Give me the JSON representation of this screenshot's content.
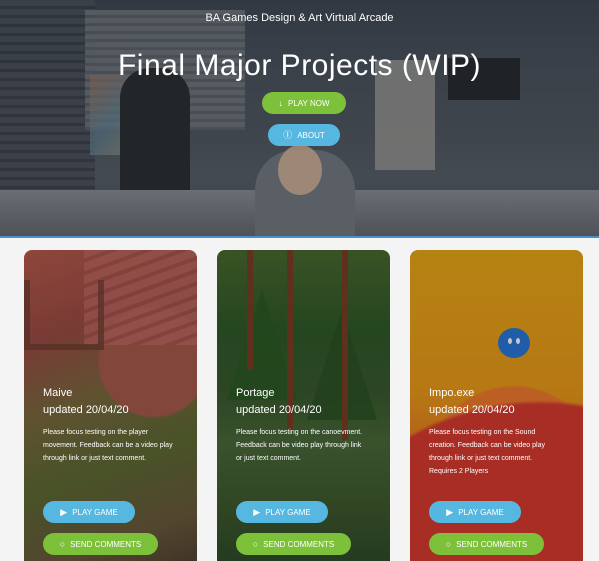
{
  "hero": {
    "subtitle": "BA Games Design & Art Virtual Arcade",
    "title": "Final Major Projects (WIP)",
    "play_now_label": "PLAY NOW",
    "about_label": "ABOUT"
  },
  "colors": {
    "green": "#7dc13a",
    "blue": "#56b8e0",
    "hero_accent": "#4a90c8"
  },
  "icons": {
    "play_now": "download-arrow-icon",
    "about": "question-circle-icon",
    "play_game": "play-circle-icon",
    "send_comments": "comment-icon"
  },
  "cards": [
    {
      "title": "Maive",
      "updated": "updated 20/04/20",
      "description": "Please focus testing on the player movement. Feedback can be a video play through link or just text comment.",
      "play_label": "PLAY GAME",
      "send_label": "SEND COMMENTS"
    },
    {
      "title": "Portage",
      "updated": "updated 20/04/20",
      "description": "Please focus testing on the canoevment. Feedback can be video play through link or just text comment.",
      "play_label": "PLAY GAME",
      "send_label": "SEND COMMENTS"
    },
    {
      "title": "Impo.exe",
      "updated": "updated 20/04/20",
      "description": "Please focus testing on the Sound creation. Feedback can be video play through link or just text comment. Requires 2 Players",
      "play_label": "PLAY GAME",
      "send_label": "SEND COMMENTS"
    }
  ]
}
